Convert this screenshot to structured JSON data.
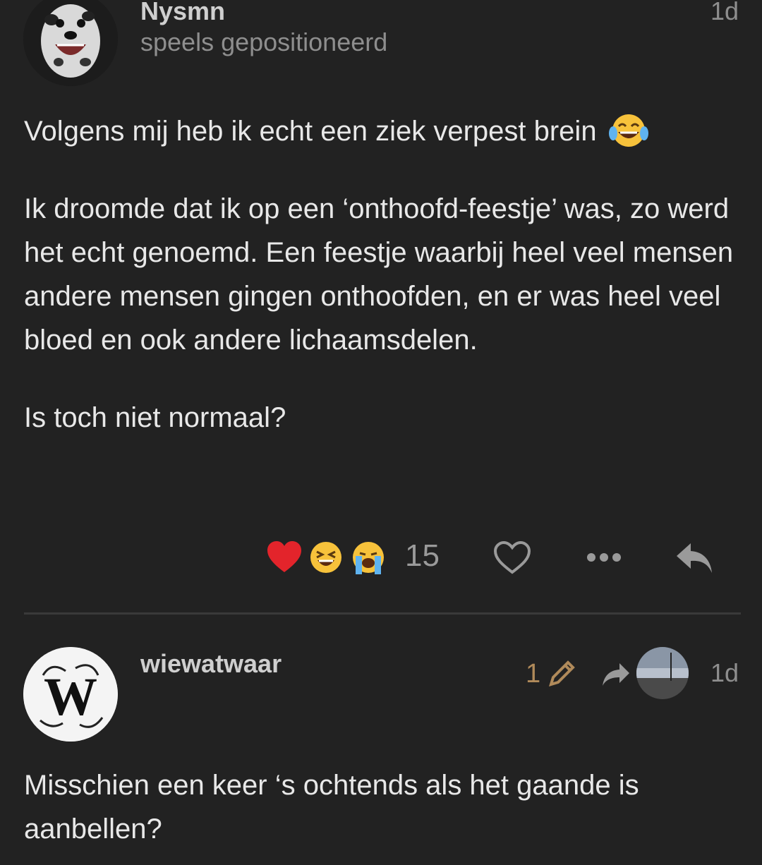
{
  "posts": [
    {
      "username": "Nysmn",
      "user_title": "speels gepositioneerd",
      "age": "1d",
      "avatar": "dalmatian-dog-avatar",
      "paragraphs": [
        "Volgens mij heb ik echt een ziek verpest brein",
        "Ik droomde dat ik op een ‘onthoofd-feestje’ was, zo werd het echt genoemd. Een feestje waarbij heel veel mensen andere mensen gingen onthoofden, en er was heel veel bloed en ook andere lichaamsdelen.",
        "Is toch niet normaal?"
      ],
      "inline_emoji": "tears-of-joy-emoji",
      "reactions": {
        "emojis": [
          "heart-emoji",
          "grinning-squinting-emoji",
          "loudly-crying-emoji"
        ],
        "count": "15"
      },
      "actions": [
        "like-heart-icon",
        "more-dots-icon",
        "reply-arrow-icon"
      ]
    },
    {
      "username": "wiewatwaar",
      "age": "1d",
      "avatar": "ornate-w-monogram-avatar",
      "edit_count": "1",
      "edit_icon": "pencil-icon",
      "reply_to_icon": "share-arrow-icon",
      "reply_to_avatar": "landscape-avatar",
      "paragraphs": [
        "Misschien een keer ‘s ochtends als het gaande is aanbellen?"
      ]
    }
  ],
  "colors": {
    "background": "#222222",
    "text": "#e8e8e8",
    "muted": "#8e8e8e",
    "edit_accent": "#b08a5a",
    "divider": "#3a3a3a"
  }
}
